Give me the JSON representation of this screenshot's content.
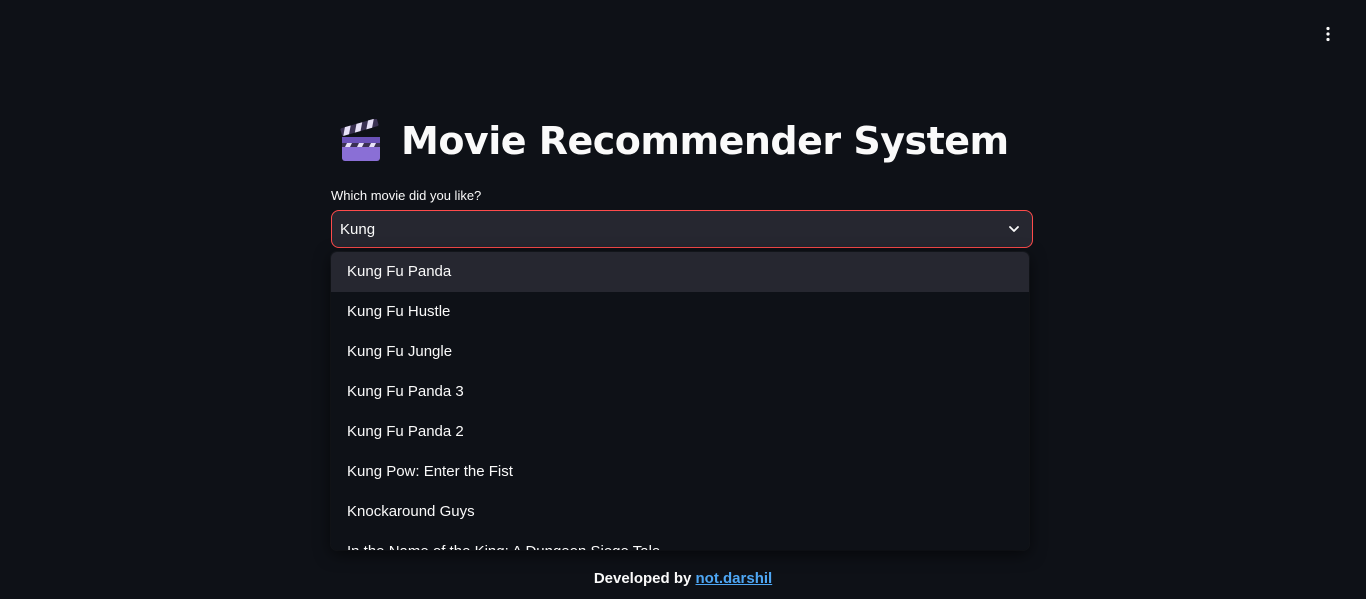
{
  "header": {
    "menu_icon": "kebab-menu-icon"
  },
  "title": {
    "icon": "clapper-board-icon",
    "text": "Movie Recommender System"
  },
  "movie_select": {
    "label": "Which movie did you like?",
    "value": "Kung",
    "chevron_icon": "chevron-down-icon",
    "accent_color": "#ff4b4b"
  },
  "dropdown": {
    "options": [
      "Kung Fu Panda",
      "Kung Fu Hustle",
      "Kung Fu Jungle",
      "Kung Fu Panda 3",
      "Kung Fu Panda 2",
      "Kung Pow: Enter the Fist",
      "Knockaround Guys",
      "In the Name of the King: A Dungeon Siege Tale"
    ],
    "highlighted_index": 0
  },
  "footer": {
    "prefix": "Developed by",
    "link_text": "not.darshil",
    "link_color": "#4ea7f5"
  }
}
